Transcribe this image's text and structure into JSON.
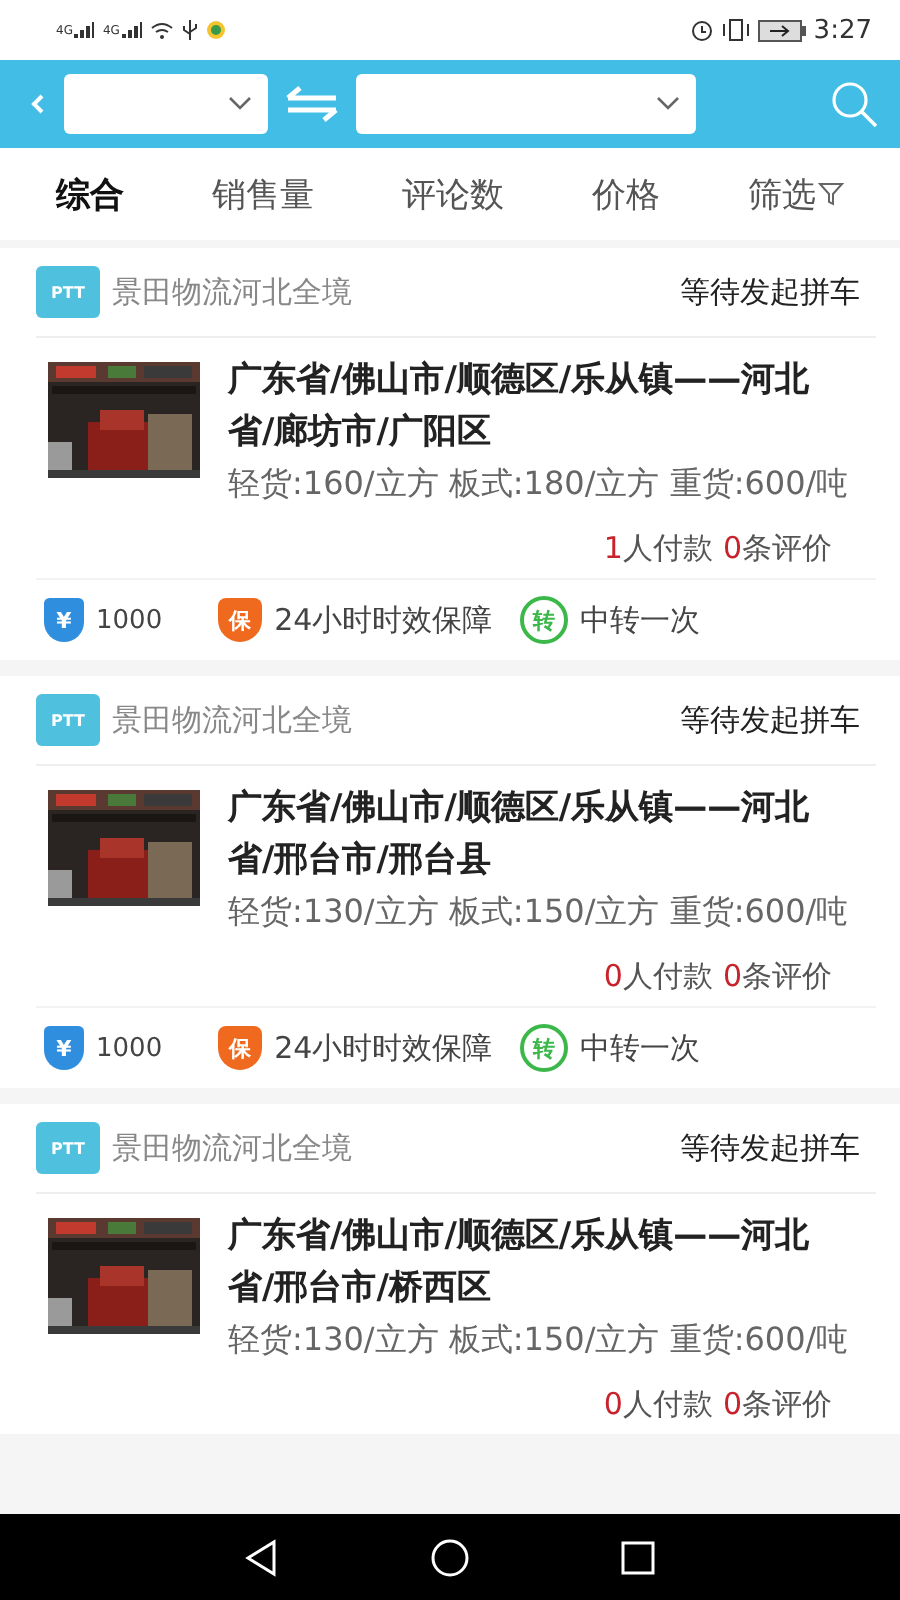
{
  "status_bar": {
    "network": [
      "4G",
      "4G"
    ],
    "time": "3:27"
  },
  "tabs": [
    {
      "label": "综合",
      "selected": true,
      "kind": "sort"
    },
    {
      "label": "销售量",
      "selected": false,
      "kind": "sort"
    },
    {
      "label": "评论数",
      "selected": false,
      "kind": "sort"
    },
    {
      "label": "价格",
      "selected": false,
      "kind": "sort"
    },
    {
      "label": "筛选",
      "selected": false,
      "kind": "filter"
    }
  ],
  "listings": [
    {
      "logo": "PTT",
      "shop": "景田物流河北全境",
      "status": "等待发起拼车",
      "route": "广东省/佛山市/顺德区/乐从镇——河北省/廊坊市/广阳区",
      "prices": "轻货:160/立方 板式:180/立方 重货:600/吨",
      "payers_count": "1",
      "payers_label": "人付款",
      "reviews_count": "0",
      "reviews_label": "条评价",
      "features": [
        {
          "kind": "deposit",
          "glyph": "¥",
          "text": "1000"
        },
        {
          "kind": "guarantee",
          "glyph": "保",
          "text": "24小时时效保障"
        },
        {
          "kind": "transfer",
          "glyph": "转",
          "text": "中转一次"
        }
      ]
    },
    {
      "logo": "PTT",
      "shop": "景田物流河北全境",
      "status": "等待发起拼车",
      "route": "广东省/佛山市/顺德区/乐从镇——河北省/邢台市/邢台县",
      "prices": "轻货:130/立方 板式:150/立方 重货:600/吨",
      "payers_count": "0",
      "payers_label": "人付款",
      "reviews_count": "0",
      "reviews_label": "条评价",
      "features": [
        {
          "kind": "deposit",
          "glyph": "¥",
          "text": "1000"
        },
        {
          "kind": "guarantee",
          "glyph": "保",
          "text": "24小时时效保障"
        },
        {
          "kind": "transfer",
          "glyph": "转",
          "text": "中转一次"
        }
      ]
    },
    {
      "logo": "PTT",
      "shop": "景田物流河北全境",
      "status": "等待发起拼车",
      "route": "广东省/佛山市/顺德区/乐从镇——河北省/邢台市/桥西区",
      "prices": "轻货:130/立方 板式:150/立方 重货:600/吨",
      "payers_count": "0",
      "payers_label": "人付款",
      "reviews_count": "0",
      "reviews_label": "条评价"
    }
  ]
}
